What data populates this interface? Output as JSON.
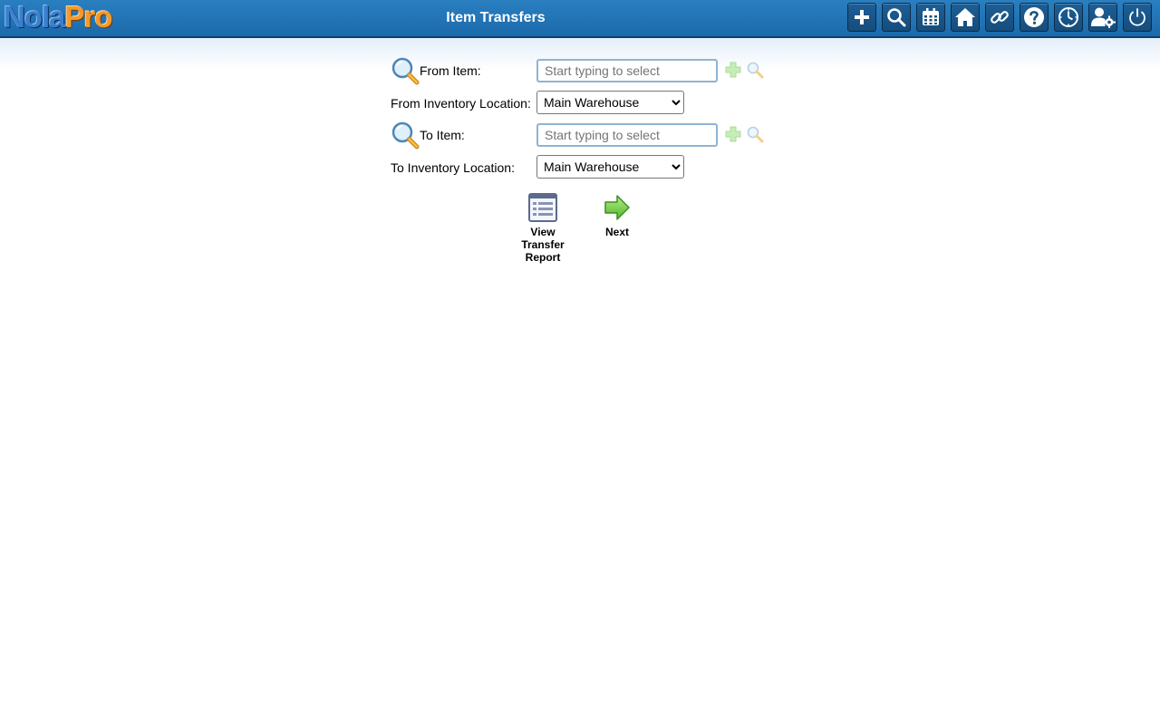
{
  "app": {
    "logo_part1": "Nola",
    "logo_part2": "Pro",
    "title": "Item Transfers"
  },
  "toolbar": [
    {
      "icon": "plus-icon"
    },
    {
      "icon": "search-icon"
    },
    {
      "icon": "calendar-icon"
    },
    {
      "icon": "home-icon"
    },
    {
      "icon": "link-icon"
    },
    {
      "icon": "help-icon"
    },
    {
      "icon": "clock-icon"
    },
    {
      "icon": "user-settings-icon"
    },
    {
      "icon": "power-icon"
    }
  ],
  "form": {
    "from_item_label": "From Item:",
    "from_item_placeholder": "Start typing to select",
    "from_location_label": "From Inventory Location:",
    "from_location_value": "Main Warehouse",
    "to_item_label": "To Item:",
    "to_item_placeholder": "Start typing to select",
    "to_location_label": "To Inventory Location:",
    "to_location_value": "Main Warehouse"
  },
  "actions": {
    "view_report_line1": "View",
    "view_report_line2": "Transfer",
    "view_report_line3": "Report",
    "next_label": "Next"
  },
  "colors": {
    "header": "#1f72b4",
    "header_border": "#0f3f6b",
    "button_bg": "#17527f",
    "input_border": "#8fb3d3"
  }
}
